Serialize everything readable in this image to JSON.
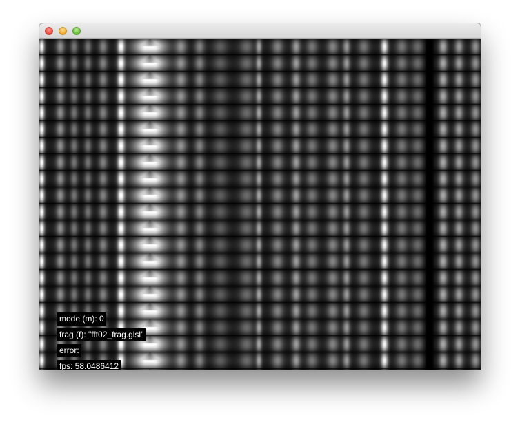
{
  "window": {
    "buttons": {
      "close": "close-button",
      "minimize": "minimize-button",
      "zoom": "zoom-button"
    }
  },
  "colors": {
    "close": "#f0554a",
    "minimize": "#f3b13b",
    "zoom": "#72c344",
    "hud_text": "#ffffff",
    "hud_background": "#000000"
  },
  "hud": {
    "mode": "mode (m): 0",
    "frag": "frag (f): \"fft02_frag.glsl\"",
    "error": "error:",
    "fps": "fps: 58.0486412"
  }
}
